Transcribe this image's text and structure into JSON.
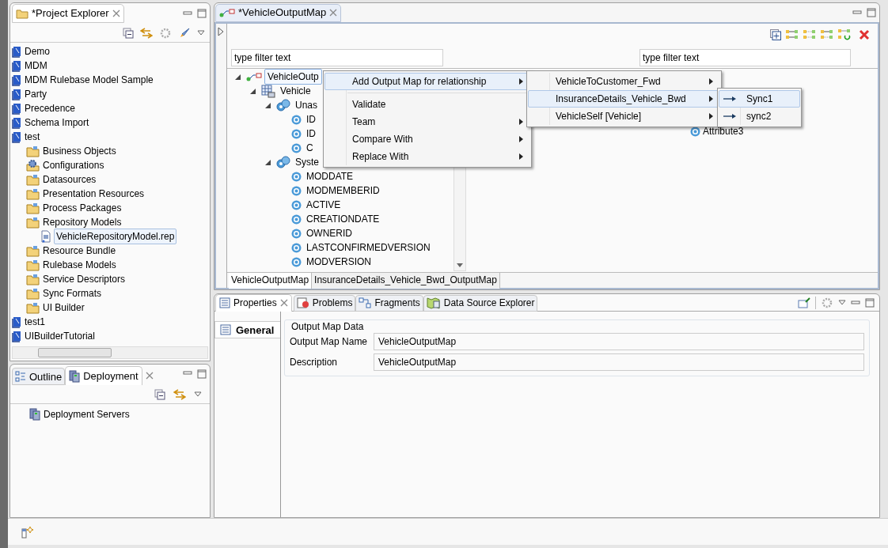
{
  "project_explorer": {
    "title": "*Project Explorer",
    "items": [
      {
        "label": "Demo",
        "kind": "project",
        "selected": false
      },
      {
        "label": "MDM",
        "kind": "project",
        "selected": false
      },
      {
        "label": "MDM Rulebase Model Sample",
        "kind": "project",
        "selected": false
      },
      {
        "label": "Party",
        "kind": "project",
        "selected": false
      },
      {
        "label": "Precedence",
        "kind": "project",
        "selected": false
      },
      {
        "label": "Schema Import",
        "kind": "project",
        "selected": false
      },
      {
        "label": "test",
        "kind": "project",
        "selected": false,
        "children": [
          {
            "label": "Business Objects",
            "kind": "folder",
            "selected": false
          },
          {
            "label": "Configurations",
            "kind": "gear",
            "selected": false
          },
          {
            "label": "Datasources",
            "kind": "folder",
            "selected": false
          },
          {
            "label": "Presentation Resources",
            "kind": "folder",
            "selected": false
          },
          {
            "label": "Process Packages",
            "kind": "folder",
            "selected": false
          },
          {
            "label": "Repository Models",
            "kind": "folder",
            "selected": false,
            "children": [
              {
                "label": "VehicleRepositoryModel.rep",
                "kind": "file",
                "selected": true
              }
            ]
          },
          {
            "label": "Resource Bundle",
            "kind": "folder",
            "selected": false
          },
          {
            "label": "Rulebase Models",
            "kind": "folder",
            "selected": false
          },
          {
            "label": "Service Descriptors",
            "kind": "folder",
            "selected": false
          },
          {
            "label": "Sync Formats",
            "kind": "folder",
            "selected": false
          },
          {
            "label": "UI Builder",
            "kind": "folder",
            "selected": false
          }
        ]
      },
      {
        "label": "test1",
        "kind": "project",
        "selected": false
      },
      {
        "label": "UIBuilderTutorial",
        "kind": "project",
        "selected": false
      }
    ]
  },
  "deployment_panel": {
    "tabs": [
      {
        "label": "Outline",
        "selected": false
      },
      {
        "label": "Deployment",
        "selected": true
      }
    ],
    "items": [
      {
        "label": "Deployment Servers"
      }
    ]
  },
  "editor": {
    "tab_title": "*VehicleOutputMap",
    "left_filter": {
      "value": "type filter text"
    },
    "right_filter": {
      "value": "type filter text"
    },
    "left_tree": [
      {
        "label": "VehicleOutp",
        "kind": "map",
        "selected": true,
        "expanded": true,
        "children": [
          {
            "label": "Vehicle",
            "kind": "table",
            "selected": false,
            "expanded": true,
            "children": [
              {
                "label": "Unas",
                "kind": "group",
                "selected": false,
                "expanded": true,
                "children": [
                  {
                    "label": "ID",
                    "kind": "attribute",
                    "selected": false
                  },
                  {
                    "label": "ID",
                    "kind": "attribute",
                    "selected": false
                  },
                  {
                    "label": "C",
                    "kind": "attribute",
                    "selected": false
                  }
                ]
              },
              {
                "label": "Syste",
                "kind": "group",
                "selected": false,
                "expanded": true,
                "children": [
                  {
                    "label": "MODDATE",
                    "kind": "attribute",
                    "selected": false
                  },
                  {
                    "label": "MODMEMBERID",
                    "kind": "attribute",
                    "selected": false
                  },
                  {
                    "label": "ACTIVE",
                    "kind": "attribute",
                    "selected": false
                  },
                  {
                    "label": "CREATIONDATE",
                    "kind": "attribute",
                    "selected": false
                  },
                  {
                    "label": "OWNERID",
                    "kind": "attribute",
                    "selected": false
                  },
                  {
                    "label": "LASTCONFIRMEDVERSION",
                    "kind": "attribute",
                    "selected": false
                  },
                  {
                    "label": "MODVERSION",
                    "kind": "attribute",
                    "selected": false
                  }
                ]
              }
            ]
          }
        ]
      }
    ],
    "right_tree": [
      {
        "label": "Attribute3",
        "kind": "attribute"
      }
    ],
    "bottom_tabs": [
      {
        "label": "VehicleOutputMap",
        "selected": true
      },
      {
        "label": "InsuranceDetails_Vehicle_Bwd_OutputMap",
        "selected": false
      }
    ]
  },
  "context_menu": {
    "items": [
      {
        "kind": "item",
        "label": "Add Output Map for relationship",
        "submenu": true,
        "selected": true
      },
      {
        "kind": "separator"
      },
      {
        "kind": "item",
        "label": "Validate",
        "submenu": false,
        "selected": false
      },
      {
        "kind": "item",
        "label": "Team",
        "submenu": true,
        "selected": false
      },
      {
        "kind": "item",
        "label": "Compare With",
        "submenu": true,
        "selected": false
      },
      {
        "kind": "item",
        "label": "Replace With",
        "submenu": true,
        "selected": false
      }
    ]
  },
  "submenu": {
    "items": [
      {
        "label": "VehicleToCustomer_Fwd",
        "selected": false
      },
      {
        "label": "InsuranceDetails_Vehicle_Bwd",
        "selected": true
      },
      {
        "label": "VehicleSelf [Vehicle]",
        "selected": false
      }
    ]
  },
  "sync_menu": {
    "items": [
      {
        "label": "Sync1",
        "selected": true
      },
      {
        "label": "sync2",
        "selected": false
      }
    ]
  },
  "properties": {
    "tabs": [
      {
        "label": "Properties",
        "selected": true
      },
      {
        "label": "Problems",
        "selected": false
      },
      {
        "label": "Fragments",
        "selected": false
      },
      {
        "label": "Data Source Explorer",
        "selected": false
      }
    ],
    "side_tabs": [
      {
        "label": "General",
        "selected": true
      }
    ],
    "section_title": "Output Map Data",
    "fields": [
      {
        "label": "Output Map Name",
        "value": "VehicleOutputMap"
      },
      {
        "label": "Description",
        "value": "VehicleOutputMap"
      }
    ]
  }
}
